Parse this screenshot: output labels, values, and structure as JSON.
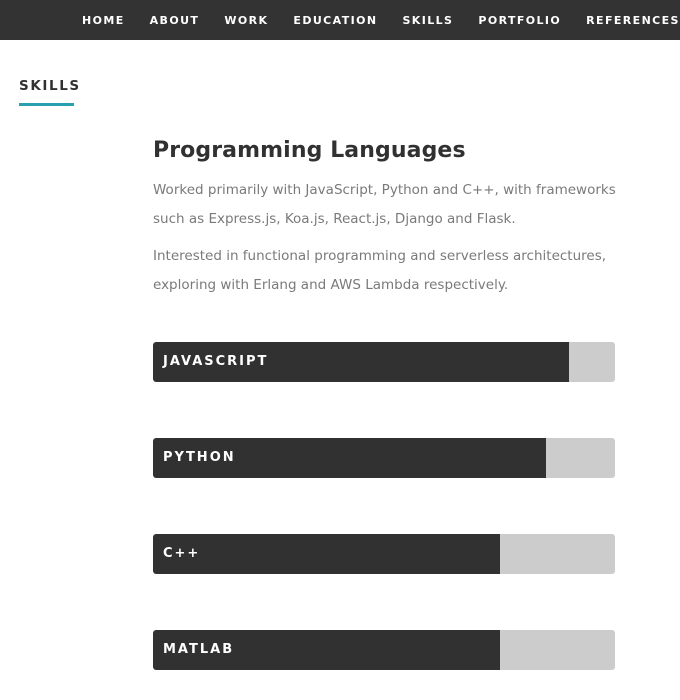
{
  "nav": {
    "items": [
      "HOME",
      "ABOUT",
      "WORK",
      "EDUCATION",
      "SKILLS",
      "PORTFOLIO",
      "REFERENCES"
    ]
  },
  "section": {
    "label": "SKILLS"
  },
  "programming": {
    "heading": "Programming Languages",
    "paragraph_1": "Worked primarily with JavaScript, Python and C++, with frameworks such as Express.js, Koa.js, React.js, Django and Flask.",
    "paragraph_2": "Interested in functional programming and serverless architectures, exploring with Erlang and AWS Lambda respectively."
  },
  "skills": [
    {
      "name": "JAVASCRIPT",
      "level": 0.9
    },
    {
      "name": "PYTHON",
      "level": 0.85
    },
    {
      "name": "C++",
      "level": 0.75
    },
    {
      "name": "MATLAB",
      "level": 0.75
    }
  ],
  "colors": {
    "nav_background": "#333333",
    "accent": "#2a9fb0",
    "bar_fill": "#313131",
    "bar_track": "#cccccc"
  }
}
